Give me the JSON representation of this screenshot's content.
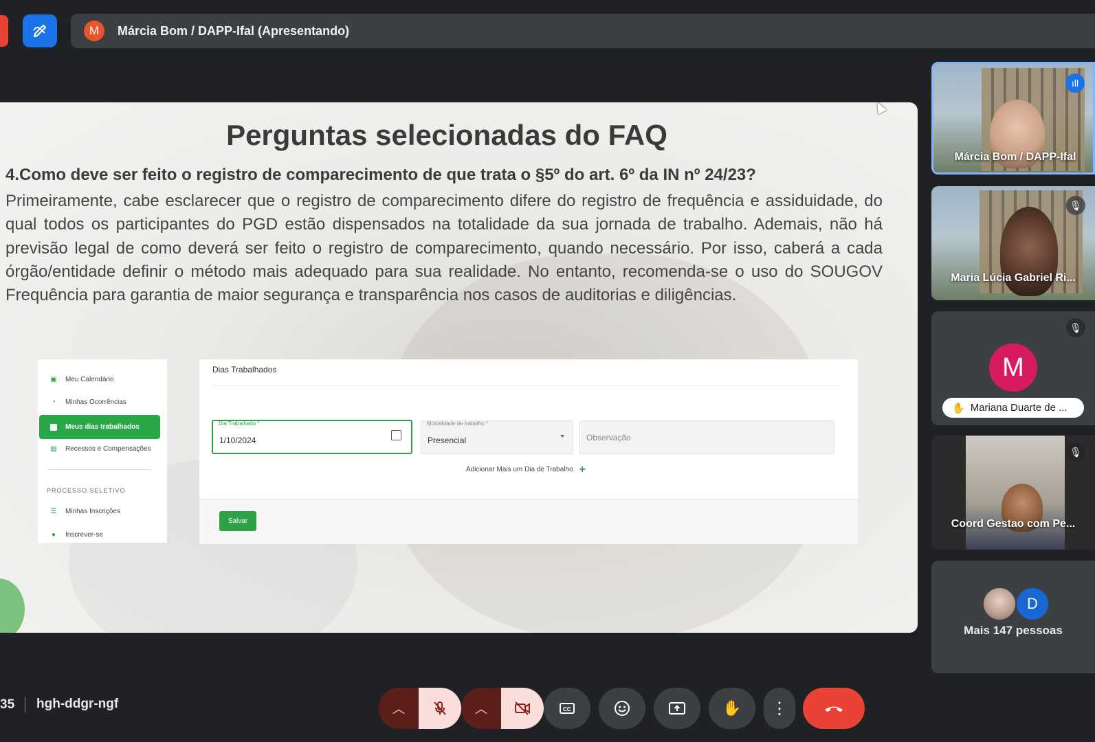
{
  "presenter": {
    "avatar_initial": "M",
    "label": "Márcia Bom / DAPP-Ifal (Apresentando)"
  },
  "slide": {
    "title": "Perguntas selecionadas do FAQ",
    "question": "4.Como deve ser feito o registro de comparecimento de que trata o §5º do art. 6º da IN nº 24/23?",
    "answer": "Primeiramente, cabe esclarecer que o registro de comparecimento difere do registro de frequência e assiduidade, do qual todos os participantes do PGD estão dispensados na totalidade da sua jornada de trabalho.  Ademais, não há previsão legal de como deverá ser feito o registro de comparecimento, quando necessário. Por isso, caberá a cada órgão/entidade definir o método mais adequado para sua realidade. No entanto, recomenda-se o uso do SOUGOV Frequência para garantia de maior segurança e transparência nos casos de auditorias e diligências.",
    "embedded": {
      "sidebar": {
        "items": [
          "Meu Calendário",
          "Minhas Ocorrências",
          "Meus dias trabalhados",
          "Recessos e Compensações"
        ],
        "section": "PROCESSO SELETIVO",
        "section_items": [
          "Minhas Inscrições",
          "Inscrever-se"
        ]
      },
      "main": {
        "heading": "Dias Trabalhados",
        "date_label": "Dia Trabalhado *",
        "date_value": "1/10/2024",
        "mode_label": "Modalidade de trabalho *",
        "mode_value": "Presencial",
        "obs_placeholder": "Observação",
        "add_day": "Adicionar Mais um Dia de Trabalho",
        "save": "Salvar"
      }
    }
  },
  "participants": [
    {
      "name": "Márcia Bom / DAPP-Ifal",
      "speaking": true
    },
    {
      "name": "Maria Lúcia Gabriel Ri...",
      "muted": true
    },
    {
      "name": "Mariana Duarte de ...",
      "initial": "M",
      "hand_raised": true,
      "muted": true
    },
    {
      "name": "Coord Gestao com Pe...",
      "muted": true
    }
  ],
  "more_people": {
    "avatar_initial": "D",
    "label": "Mais 147 pessoas"
  },
  "meeting": {
    "time": "35",
    "code": "hgh-ddgr-ngf"
  },
  "colors": {
    "end_call": "#ea4335",
    "accent": "#1a73e8",
    "sougov_green": "#27a745"
  }
}
